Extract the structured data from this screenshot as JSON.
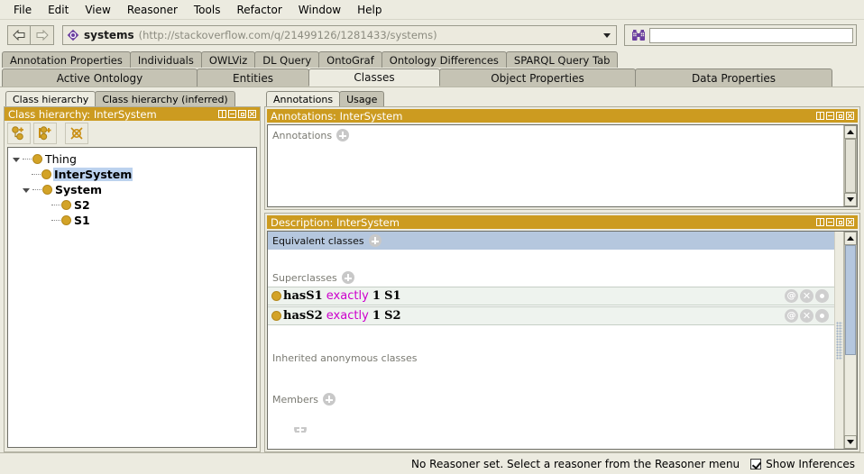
{
  "menu": {
    "items": [
      {
        "label": "File"
      },
      {
        "label": "Edit"
      },
      {
        "label": "View"
      },
      {
        "label": "Reasoner"
      },
      {
        "label": "Tools"
      },
      {
        "label": "Refactor"
      },
      {
        "label": "Window"
      },
      {
        "label": "Help"
      }
    ]
  },
  "toolbar": {
    "back_icon": "back-arrow-icon",
    "forward_icon": "forward-arrow-icon",
    "ontology_icon": "ontology-icon",
    "ontology_name": "systems",
    "ontology_uri": "(http://stackoverflow.com/q/21499126/1281433/systems)",
    "search_icon": "binoculars-icon",
    "search_value": "",
    "search_placeholder": ""
  },
  "tabs_row1": [
    {
      "label": "Annotation Properties",
      "active": false
    },
    {
      "label": "Individuals",
      "active": false
    },
    {
      "label": "OWLViz",
      "active": false
    },
    {
      "label": "DL Query",
      "active": false
    },
    {
      "label": "OntoGraf",
      "active": false
    },
    {
      "label": "Ontology Differences",
      "active": false
    },
    {
      "label": "SPARQL Query Tab",
      "active": false
    }
  ],
  "tabs_row2": [
    {
      "label": "Active Ontology",
      "active": false
    },
    {
      "label": "Entities",
      "active": false
    },
    {
      "label": "Classes",
      "active": true
    },
    {
      "label": "Object Properties",
      "active": false
    },
    {
      "label": "Data Properties",
      "active": false
    }
  ],
  "left_pane": {
    "tabs": [
      {
        "label": "Class hierarchy",
        "active": true
      },
      {
        "label": "Class hierarchy (inferred)",
        "active": false
      }
    ],
    "panel_title": "Class hierarchy: InterSystem",
    "toolbar_buttons": [
      {
        "name": "add-subclass-button",
        "icon": "add-subclass-icon"
      },
      {
        "name": "add-sibling-class-button",
        "icon": "add-sibling-class-icon"
      },
      {
        "name": "delete-class-button",
        "icon": "delete-class-icon"
      }
    ],
    "tree": [
      {
        "label": "Thing",
        "depth": 0,
        "expanded": true,
        "selected": false,
        "bold": false
      },
      {
        "label": "InterSystem",
        "depth": 1,
        "expanded": false,
        "selected": true,
        "bold": true
      },
      {
        "label": "System",
        "depth": 1,
        "expanded": true,
        "selected": false,
        "bold": true
      },
      {
        "label": "S2",
        "depth": 2,
        "expanded": false,
        "selected": false,
        "bold": true
      },
      {
        "label": "S1",
        "depth": 2,
        "expanded": false,
        "selected": false,
        "bold": true
      }
    ]
  },
  "annotations_panel": {
    "tabs": [
      {
        "label": "Annotations",
        "active": true
      },
      {
        "label": "Usage",
        "active": false
      }
    ],
    "panel_title": "Annotations: InterSystem",
    "section_label": "Annotations"
  },
  "description_panel": {
    "panel_title": "Description: InterSystem",
    "sections": [
      {
        "label": "Equivalent classes",
        "selected": true
      },
      {
        "label": "Superclasses",
        "selected": false
      },
      {
        "label": "Inherited anonymous classes",
        "selected": false,
        "no_plus": true
      },
      {
        "label": "Members",
        "selected": false
      }
    ],
    "superclass_rows": [
      {
        "property": "hasS1",
        "keyword": "exactly",
        "cardinality": "1",
        "filler": "S1"
      },
      {
        "property": "hasS2",
        "keyword": "exactly",
        "cardinality": "1",
        "filler": "S2"
      }
    ],
    "row_icons": [
      {
        "name": "annotate-icon",
        "glyph": "@"
      },
      {
        "name": "delete-icon",
        "glyph": "✕"
      },
      {
        "name": "edit-icon",
        "glyph": ""
      }
    ]
  },
  "statusbar": {
    "message": "No Reasoner set. Select a reasoner from the Reasoner menu",
    "show_inferences_label": "Show Inferences",
    "show_inferences_checked": true
  },
  "colors": {
    "panel_title_bg": "#cc9b20",
    "selection_bg": "#bcd2ee",
    "keyword": "#cc00cc",
    "class_bullet": "#d3a327",
    "window_bg": "#ecebe0"
  }
}
